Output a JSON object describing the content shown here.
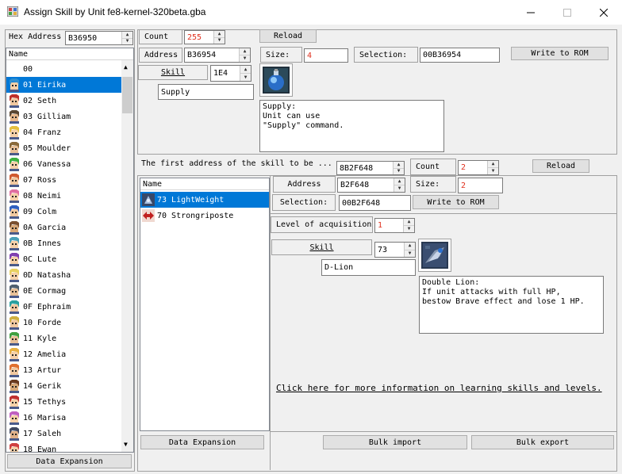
{
  "window": {
    "title": "Assign Skill by Unit fe8-kernel-320beta.gba"
  },
  "left": {
    "hex_address_label": "Hex Address",
    "hex_address_value": "B36950",
    "list_header": "Name",
    "units": [
      {
        "label": "00",
        "hair": "",
        "skin": ""
      },
      {
        "label": "01 Eirika",
        "hair": "#2f8fd0",
        "skin": "#f5d0a8"
      },
      {
        "label": "02 Seth",
        "hair": "#c0302a",
        "skin": "#f0c8a0"
      },
      {
        "label": "03 Gilliam",
        "hair": "#5a4632",
        "skin": "#e8b88c"
      },
      {
        "label": "04 Franz",
        "hair": "#e6c040",
        "skin": "#f5d0a8"
      },
      {
        "label": "05 Moulder",
        "hair": "#8a6a3a",
        "skin": "#e8c098"
      },
      {
        "label": "06 Vanessa",
        "hair": "#3cb040",
        "skin": "#f5d0a8"
      },
      {
        "label": "07 Ross",
        "hair": "#d05a30",
        "skin": "#f0c8a0"
      },
      {
        "label": "08 Neimi",
        "hair": "#e070a0",
        "skin": "#f5d0a8"
      },
      {
        "label": "09 Colm",
        "hair": "#3060c0",
        "skin": "#f0c8a0"
      },
      {
        "label": "0A Garcia",
        "hair": "#7a5030",
        "skin": "#d8a878"
      },
      {
        "label": "0B Innes",
        "hair": "#4aa0b8",
        "skin": "#f5d0a8"
      },
      {
        "label": "0C Lute",
        "hair": "#8040b0",
        "skin": "#f5d0a8"
      },
      {
        "label": "0D Natasha",
        "hair": "#e8d060",
        "skin": "#f5d0a8"
      },
      {
        "label": "0E Cormag",
        "hair": "#506070",
        "skin": "#e8c098"
      },
      {
        "label": "0F Ephraim",
        "hair": "#2aa0a0",
        "skin": "#f0c8a0"
      },
      {
        "label": "10 Forde",
        "hair": "#d0b040",
        "skin": "#f0c8a0"
      },
      {
        "label": "11 Kyle",
        "hair": "#40a040",
        "skin": "#e8c098"
      },
      {
        "label": "12 Amelia",
        "hair": "#e8b040",
        "skin": "#f5d0a8"
      },
      {
        "label": "13 Artur",
        "hair": "#e07030",
        "skin": "#f0c8a0"
      },
      {
        "label": "14 Gerik",
        "hair": "#6a3a20",
        "skin": "#d8a878"
      },
      {
        "label": "15 Tethys",
        "hair": "#c03030",
        "skin": "#f5d0a8"
      },
      {
        "label": "16 Marisa",
        "hair": "#c060c0",
        "skin": "#f5d0a8"
      },
      {
        "label": "17 Saleh",
        "hair": "#404860",
        "skin": "#e0b088"
      },
      {
        "label": "18 Ewan",
        "hair": "#d04040",
        "skin": "#f5d0a8"
      }
    ],
    "data_expansion": "Data Expansion"
  },
  "top": {
    "count_label": "Count",
    "count_value": "255",
    "reload": "Reload",
    "address_label": "Address",
    "address_value": "B36954",
    "size_label": "Size:",
    "size_value": "4",
    "selection_label": "Selection:",
    "selection_value": "00B36954",
    "write_to_rom": "Write to ROM",
    "skill_label": "Skill",
    "skill_value": "1E4",
    "skill_name": "Supply",
    "skill_desc": "Supply:\nUnit can use\n\"Supply\" command."
  },
  "lower": {
    "first_address_label": "The first address of the skill to be ...",
    "first_address_value": "8B2F648",
    "count_label": "Count",
    "count_value": "2",
    "reload": "Reload",
    "list_header": "Name",
    "skills": [
      {
        "label": "73 LightWeight",
        "icon": "lightweight-icon"
      },
      {
        "label": "70 Strongriposte",
        "icon": "strongriposte-icon"
      }
    ],
    "address_label": "Address",
    "address_value": "B2F648",
    "size_label": "Size:",
    "size_value": "2",
    "selection_label": "Selection:",
    "selection_value": "00B2F648",
    "write_to_rom": "Write to ROM",
    "level_label": "Level of acquisition",
    "level_value": "1",
    "skill_label": "Skill",
    "skill_value": "73",
    "skill_name": "D-Lion",
    "skill_desc": "Double Lion:\nIf unit attacks with full HP,\nbestow Brave effect and lose 1 HP.",
    "info_link": "Click here for more information on learning skills and levels.",
    "data_expansion": "Data Expansion",
    "bulk_import": "Bulk import",
    "bulk_export": "Bulk export"
  }
}
